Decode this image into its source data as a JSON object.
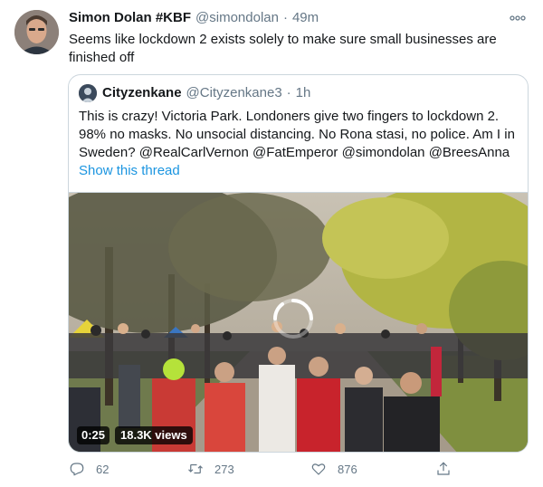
{
  "tweet": {
    "author_name": "Simon Dolan #KBF",
    "author_handle": "@simondolan",
    "separator": "·",
    "time": "49m",
    "text": "Seems like lockdown 2 exists solely to make sure small businesses are finished off",
    "more_icon": "more-dots-icon"
  },
  "quoted": {
    "author_name": "Cityzenkane",
    "author_handle": "@Cityzenkane3",
    "separator": "·",
    "time": "1h",
    "text": "This is crazy! Victoria Park. Londoners give two fingers to lockdown 2. 98% no masks. No unsocial distancing. No Rona stasi, no police. Am I in Sweden? @RealCarlVernon @FatEmperor @simondolan @BreesAnna",
    "show_thread": "Show this thread",
    "link_color": "#1b95e0"
  },
  "video": {
    "duration": "0:25",
    "views": "18.3K views",
    "loading_icon": "loading-spinner-icon"
  },
  "actions": {
    "replies": "62",
    "retweets": "273",
    "likes": "876",
    "reply_icon": "reply-icon",
    "retweet_icon": "retweet-icon",
    "like_icon": "heart-icon",
    "share_icon": "share-icon",
    "muted_color": "#657786"
  }
}
